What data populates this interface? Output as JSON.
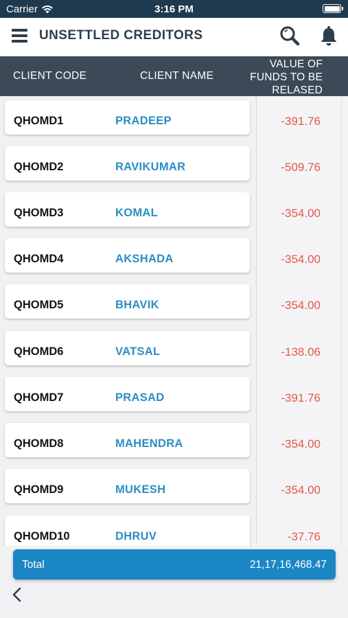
{
  "status_bar": {
    "carrier": "Carrier",
    "time": "3:16 PM"
  },
  "nav": {
    "title": "UNSETTLED CREDITORS",
    "icons": [
      "menu-icon",
      "search-icon",
      "bell-icon"
    ]
  },
  "table": {
    "headers": {
      "code": "CLIENT CODE",
      "name": "CLIENT NAME",
      "value_line1": "VALUE OF",
      "value_line2": "FUNDS TO BE",
      "value_line3": "RELASED"
    },
    "rows": [
      {
        "code": "QHOMD1",
        "name": "PRADEEP",
        "value": "-391.76"
      },
      {
        "code": "QHOMD2",
        "name": "RAVIKUMAR",
        "value": "-509.76"
      },
      {
        "code": "QHOMD3",
        "name": "KOMAL",
        "value": "-354.00"
      },
      {
        "code": "QHOMD4",
        "name": "AKSHADA",
        "value": "-354.00"
      },
      {
        "code": "QHOMD5",
        "name": "BHAVIK",
        "value": "-354.00"
      },
      {
        "code": "QHOMD6",
        "name": "VATSAL",
        "value": "-138.06"
      },
      {
        "code": "QHOMD7",
        "name": "PRASAD",
        "value": "-391.76"
      },
      {
        "code": "QHOMD8",
        "name": "MAHENDRA",
        "value": "-354.00"
      },
      {
        "code": "QHOMD9",
        "name": "MUKESH",
        "value": "-354.00"
      },
      {
        "code": "QHOMD10",
        "name": "DHRUV",
        "value": "-37.76"
      }
    ]
  },
  "total": {
    "label": "Total",
    "value": "21,17,16,468.47"
  },
  "colors": {
    "status_bar": "#1f3a4f",
    "header": "#3c4a57",
    "name_text": "#2a8ec4",
    "negative_value": "#e3584a",
    "total_bar": "#1b86c4"
  }
}
